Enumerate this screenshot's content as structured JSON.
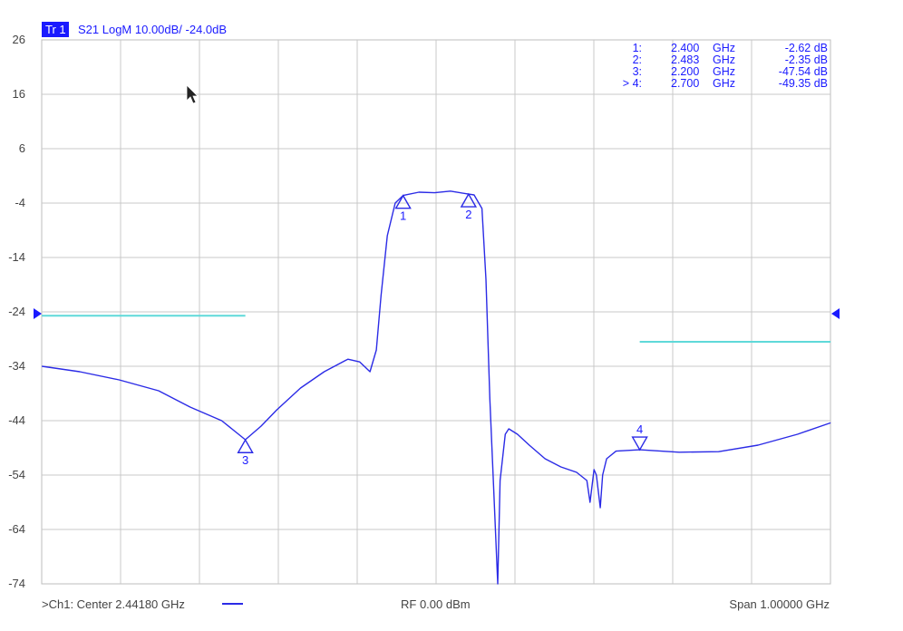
{
  "trace_header": {
    "badge": "Tr 1",
    "label": "S21 LogM 10.00dB/  -24.0dB"
  },
  "footer": {
    "center": ">Ch1:  Center  2.44180 GHz",
    "rf": "RF   0.00  dBm",
    "span": "Span  1.00000 GHz"
  },
  "colors": {
    "trace": "#2b2be6",
    "text": "#1a1aff",
    "limit": "#5fd9d9",
    "grid": "#c8c8c8",
    "badge_bg": "#1a1aff",
    "badge_text": "#ffffff"
  },
  "icons": {
    "pointer": "mouse-pointer-icon",
    "ref_left": "reference-level-left-arrow-icon",
    "ref_right": "reference-level-right-arrow-icon"
  },
  "marker_table": [
    {
      "index": "1:",
      "freq": "2.400",
      "unit": "GHz",
      "value": "-2.62 dB"
    },
    {
      "index": "2:",
      "freq": "2.483",
      "unit": "GHz",
      "value": "-2.35 dB"
    },
    {
      "index": "3:",
      "freq": "2.200",
      "unit": "GHz",
      "value": "-47.54 dB"
    },
    {
      "index": "> 4:",
      "freq": "2.700",
      "unit": "GHz",
      "value": "-49.35 dB"
    }
  ],
  "chart_data": {
    "type": "line",
    "title": "",
    "xlabel": "",
    "ylabel": "",
    "x_unit": "GHz",
    "y_unit": "dB",
    "xlim": [
      1.9418,
      2.9418
    ],
    "ylim": [
      -74,
      26
    ],
    "grid": true,
    "y_ticks": [
      26,
      16,
      6,
      -4,
      -14,
      -24,
      -34,
      -44,
      -54,
      -64,
      -74
    ],
    "reference_level_db": -24,
    "series": [
      {
        "x": [
          1.942,
          1.99,
          2.04,
          2.09,
          2.13,
          2.17,
          2.2,
          2.22,
          2.24,
          2.27,
          2.3,
          2.33,
          2.345,
          2.358,
          2.366,
          2.372,
          2.38,
          2.39,
          2.4,
          2.42,
          2.44,
          2.46,
          2.483,
          2.49,
          2.5,
          2.505,
          2.51,
          2.52,
          2.523,
          2.5295,
          2.534,
          2.545,
          2.56,
          2.58,
          2.6,
          2.62,
          2.633,
          2.637,
          2.642,
          2.645,
          2.65,
          2.653,
          2.658,
          2.67,
          2.7,
          2.75,
          2.8,
          2.85,
          2.9,
          2.942
        ],
        "y": [
          -34,
          -35,
          -36.5,
          -38.5,
          -41.5,
          -44,
          -47.5,
          -45,
          -42,
          -38,
          -35,
          -32.7,
          -33.2,
          -35,
          -31,
          -21,
          -10,
          -4,
          -2.6,
          -2.0,
          -2.1,
          -1.8,
          -2.35,
          -2.5,
          -5,
          -18,
          -40,
          -74,
          -55,
          -46.5,
          -45.5,
          -46.5,
          -48.5,
          -51,
          -52.5,
          -53.5,
          -55,
          -59,
          -53,
          -54,
          -60,
          -54,
          -51,
          -49.6,
          -49.35,
          -49.8,
          -49.7,
          -48.5,
          -46.5,
          -44.4
        ]
      }
    ],
    "limit_lines": [
      {
        "x": [
          1.942,
          2.2
        ],
        "y": [
          -24.7,
          -24.7
        ]
      },
      {
        "x": [
          2.7,
          2.942
        ],
        "y": [
          -29.5,
          -29.5
        ]
      }
    ],
    "markers": [
      {
        "label": "1",
        "x": 2.4,
        "y": -2.62,
        "direction": "up"
      },
      {
        "label": "2",
        "x": 2.483,
        "y": -2.35,
        "direction": "up"
      },
      {
        "label": "3",
        "x": 2.2,
        "y": -47.54,
        "direction": "up"
      },
      {
        "label": "4",
        "x": 2.7,
        "y": -49.35,
        "direction": "down"
      }
    ]
  }
}
